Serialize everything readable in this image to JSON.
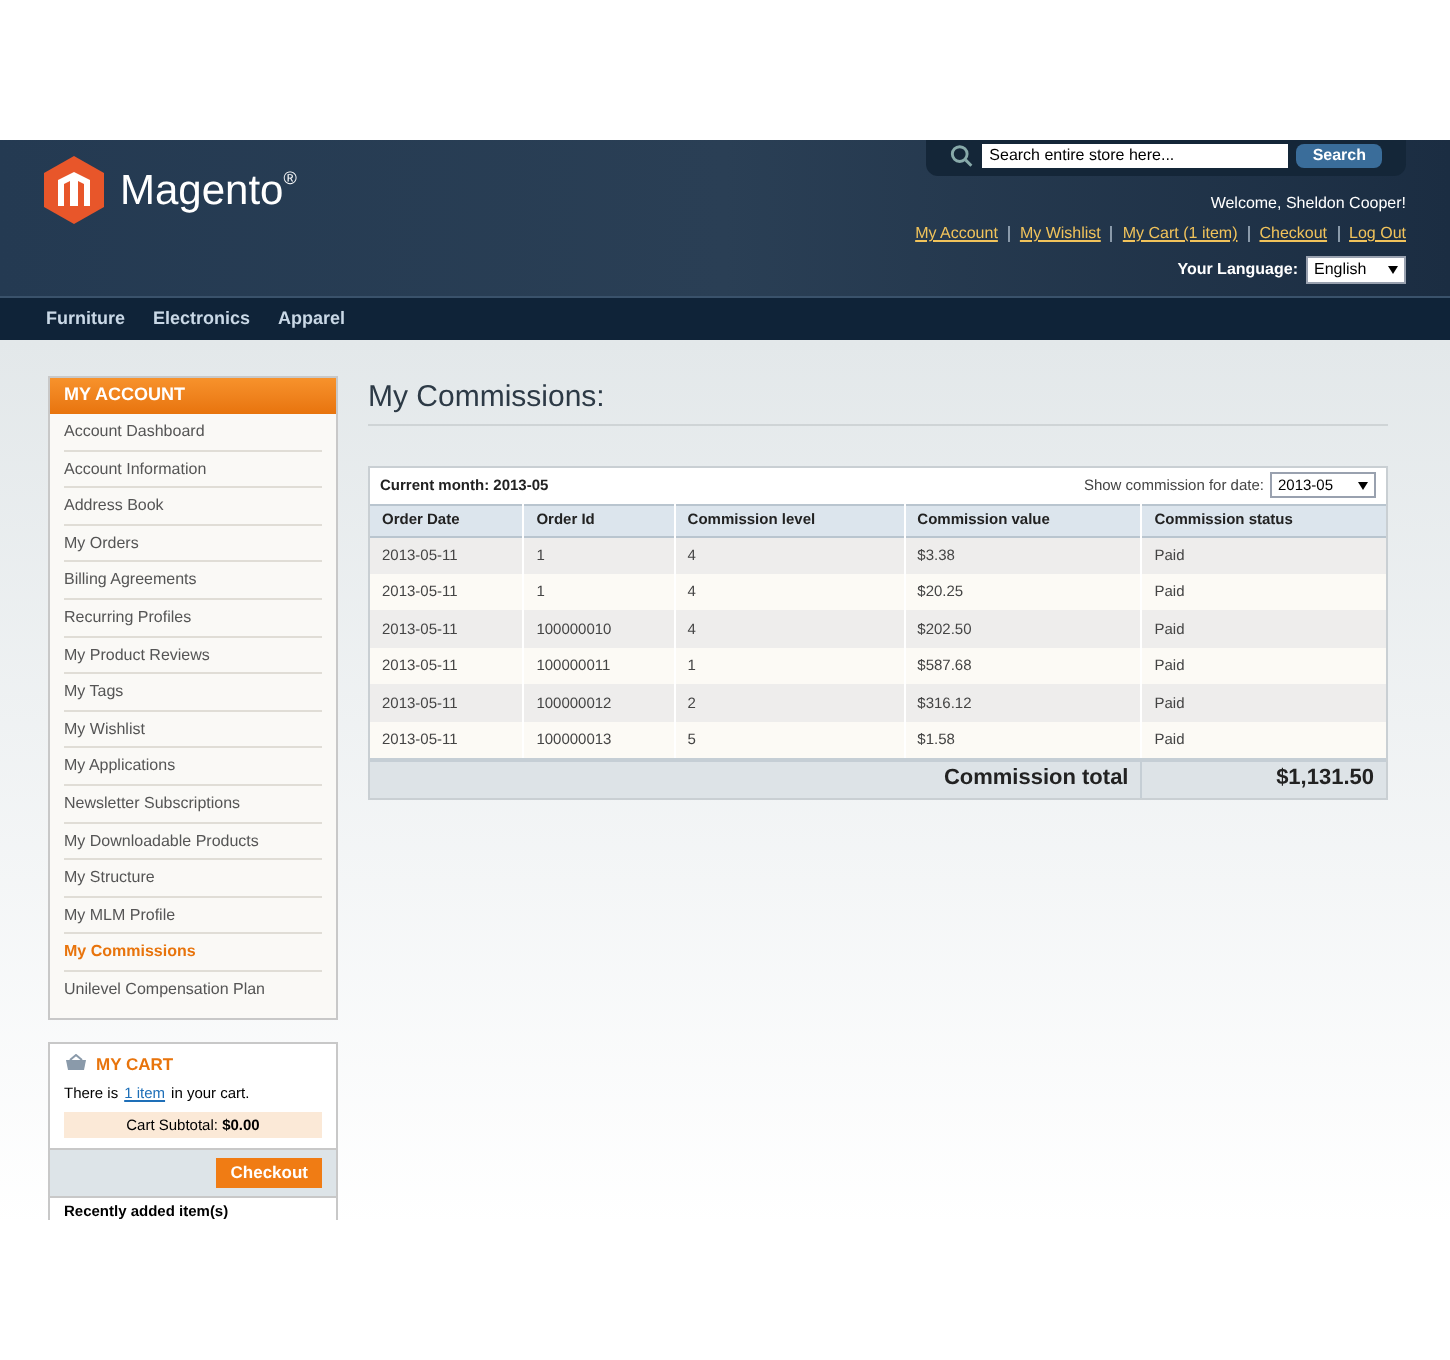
{
  "header": {
    "logo": "Magento",
    "logo_mark": "®",
    "search": {
      "placeholder": "Search entire store here...",
      "button": "Search"
    },
    "welcome": "Welcome, Sheldon Cooper!",
    "links": [
      "My Account",
      "My Wishlist",
      "My Cart (1 item)",
      "Checkout",
      "Log Out"
    ],
    "language": {
      "label": "Your Language:",
      "value": "English"
    }
  },
  "nav": [
    "Furniture",
    "Electronics",
    "Apparel"
  ],
  "sidebar": {
    "title": "MY ACCOUNT",
    "items": [
      {
        "label": "Account Dashboard",
        "selected": false
      },
      {
        "label": "Account Information",
        "selected": false
      },
      {
        "label": "Address Book",
        "selected": false
      },
      {
        "label": "My Orders",
        "selected": false
      },
      {
        "label": "Billing Agreements",
        "selected": false
      },
      {
        "label": "Recurring Profiles",
        "selected": false
      },
      {
        "label": "My Product Reviews",
        "selected": false
      },
      {
        "label": "My Tags",
        "selected": false
      },
      {
        "label": "My Wishlist",
        "selected": false
      },
      {
        "label": "My Applications",
        "selected": false
      },
      {
        "label": "Newsletter Subscriptions",
        "selected": false
      },
      {
        "label": "My Downloadable Products",
        "selected": false
      },
      {
        "label": "My Structure",
        "selected": false
      },
      {
        "label": "My MLM Profile",
        "selected": false
      },
      {
        "label": "My Commissions",
        "selected": true
      },
      {
        "label": "Unilevel Compensation Plan",
        "selected": false
      }
    ]
  },
  "cart": {
    "title": "MY CART",
    "text_before": "There is",
    "link": "1 item",
    "text_after": "in your cart.",
    "subtotal": "Cart Subtotal: **$0.00**",
    "checkout": "Checkout",
    "recent": "Recently added item(s)"
  },
  "main": {
    "title": "My Commissions:",
    "current_month": "Current month: 2013-05",
    "filter_label": "Show commission for date:",
    "filter_value": "2013-05",
    "table": {
      "columns": [
        "Order Date",
        "Order Id",
        "Commission level",
        "Commission value",
        "Commission status"
      ],
      "rows": [
        [
          "2013-05-11",
          "1",
          "4",
          "$3.38",
          "Paid"
        ],
        [
          "2013-05-11",
          "1",
          "4",
          "$20.25",
          "Paid"
        ],
        [
          "2013-05-11",
          "100000010",
          "4",
          "$202.50",
          "Paid"
        ],
        [
          "2013-05-11",
          "100000011",
          "1",
          "$587.68",
          "Paid"
        ],
        [
          "2013-05-11",
          "100000012",
          "2",
          "$316.12",
          "Paid"
        ],
        [
          "2013-05-11",
          "100000013",
          "5",
          "$1.58",
          "Paid"
        ]
      ],
      "total_label": "Commission total",
      "total_value": "$1,131.50"
    }
  }
}
